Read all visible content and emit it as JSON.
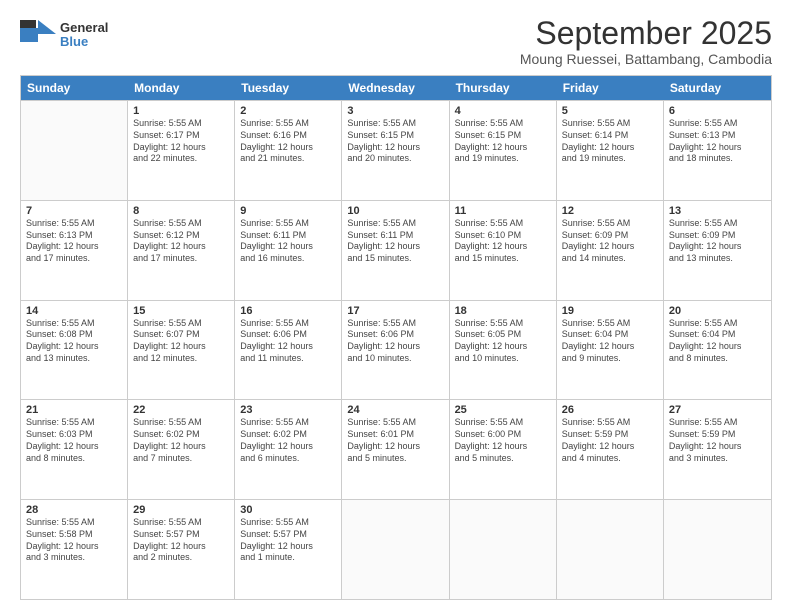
{
  "logo": {
    "general": "General",
    "blue": "Blue"
  },
  "title": "September 2025",
  "subtitle": "Moung Ruessei, Battambang, Cambodia",
  "header_days": [
    "Sunday",
    "Monday",
    "Tuesday",
    "Wednesday",
    "Thursday",
    "Friday",
    "Saturday"
  ],
  "weeks": [
    [
      {
        "day": "",
        "info": ""
      },
      {
        "day": "1",
        "info": "Sunrise: 5:55 AM\nSunset: 6:17 PM\nDaylight: 12 hours\nand 22 minutes."
      },
      {
        "day": "2",
        "info": "Sunrise: 5:55 AM\nSunset: 6:16 PM\nDaylight: 12 hours\nand 21 minutes."
      },
      {
        "day": "3",
        "info": "Sunrise: 5:55 AM\nSunset: 6:15 PM\nDaylight: 12 hours\nand 20 minutes."
      },
      {
        "day": "4",
        "info": "Sunrise: 5:55 AM\nSunset: 6:15 PM\nDaylight: 12 hours\nand 19 minutes."
      },
      {
        "day": "5",
        "info": "Sunrise: 5:55 AM\nSunset: 6:14 PM\nDaylight: 12 hours\nand 19 minutes."
      },
      {
        "day": "6",
        "info": "Sunrise: 5:55 AM\nSunset: 6:13 PM\nDaylight: 12 hours\nand 18 minutes."
      }
    ],
    [
      {
        "day": "7",
        "info": "Sunrise: 5:55 AM\nSunset: 6:13 PM\nDaylight: 12 hours\nand 17 minutes."
      },
      {
        "day": "8",
        "info": "Sunrise: 5:55 AM\nSunset: 6:12 PM\nDaylight: 12 hours\nand 17 minutes."
      },
      {
        "day": "9",
        "info": "Sunrise: 5:55 AM\nSunset: 6:11 PM\nDaylight: 12 hours\nand 16 minutes."
      },
      {
        "day": "10",
        "info": "Sunrise: 5:55 AM\nSunset: 6:11 PM\nDaylight: 12 hours\nand 15 minutes."
      },
      {
        "day": "11",
        "info": "Sunrise: 5:55 AM\nSunset: 6:10 PM\nDaylight: 12 hours\nand 15 minutes."
      },
      {
        "day": "12",
        "info": "Sunrise: 5:55 AM\nSunset: 6:09 PM\nDaylight: 12 hours\nand 14 minutes."
      },
      {
        "day": "13",
        "info": "Sunrise: 5:55 AM\nSunset: 6:09 PM\nDaylight: 12 hours\nand 13 minutes."
      }
    ],
    [
      {
        "day": "14",
        "info": "Sunrise: 5:55 AM\nSunset: 6:08 PM\nDaylight: 12 hours\nand 13 minutes."
      },
      {
        "day": "15",
        "info": "Sunrise: 5:55 AM\nSunset: 6:07 PM\nDaylight: 12 hours\nand 12 minutes."
      },
      {
        "day": "16",
        "info": "Sunrise: 5:55 AM\nSunset: 6:06 PM\nDaylight: 12 hours\nand 11 minutes."
      },
      {
        "day": "17",
        "info": "Sunrise: 5:55 AM\nSunset: 6:06 PM\nDaylight: 12 hours\nand 10 minutes."
      },
      {
        "day": "18",
        "info": "Sunrise: 5:55 AM\nSunset: 6:05 PM\nDaylight: 12 hours\nand 10 minutes."
      },
      {
        "day": "19",
        "info": "Sunrise: 5:55 AM\nSunset: 6:04 PM\nDaylight: 12 hours\nand 9 minutes."
      },
      {
        "day": "20",
        "info": "Sunrise: 5:55 AM\nSunset: 6:04 PM\nDaylight: 12 hours\nand 8 minutes."
      }
    ],
    [
      {
        "day": "21",
        "info": "Sunrise: 5:55 AM\nSunset: 6:03 PM\nDaylight: 12 hours\nand 8 minutes."
      },
      {
        "day": "22",
        "info": "Sunrise: 5:55 AM\nSunset: 6:02 PM\nDaylight: 12 hours\nand 7 minutes."
      },
      {
        "day": "23",
        "info": "Sunrise: 5:55 AM\nSunset: 6:02 PM\nDaylight: 12 hours\nand 6 minutes."
      },
      {
        "day": "24",
        "info": "Sunrise: 5:55 AM\nSunset: 6:01 PM\nDaylight: 12 hours\nand 5 minutes."
      },
      {
        "day": "25",
        "info": "Sunrise: 5:55 AM\nSunset: 6:00 PM\nDaylight: 12 hours\nand 5 minutes."
      },
      {
        "day": "26",
        "info": "Sunrise: 5:55 AM\nSunset: 5:59 PM\nDaylight: 12 hours\nand 4 minutes."
      },
      {
        "day": "27",
        "info": "Sunrise: 5:55 AM\nSunset: 5:59 PM\nDaylight: 12 hours\nand 3 minutes."
      }
    ],
    [
      {
        "day": "28",
        "info": "Sunrise: 5:55 AM\nSunset: 5:58 PM\nDaylight: 12 hours\nand 3 minutes."
      },
      {
        "day": "29",
        "info": "Sunrise: 5:55 AM\nSunset: 5:57 PM\nDaylight: 12 hours\nand 2 minutes."
      },
      {
        "day": "30",
        "info": "Sunrise: 5:55 AM\nSunset: 5:57 PM\nDaylight: 12 hours\nand 1 minute."
      },
      {
        "day": "",
        "info": ""
      },
      {
        "day": "",
        "info": ""
      },
      {
        "day": "",
        "info": ""
      },
      {
        "day": "",
        "info": ""
      }
    ]
  ]
}
